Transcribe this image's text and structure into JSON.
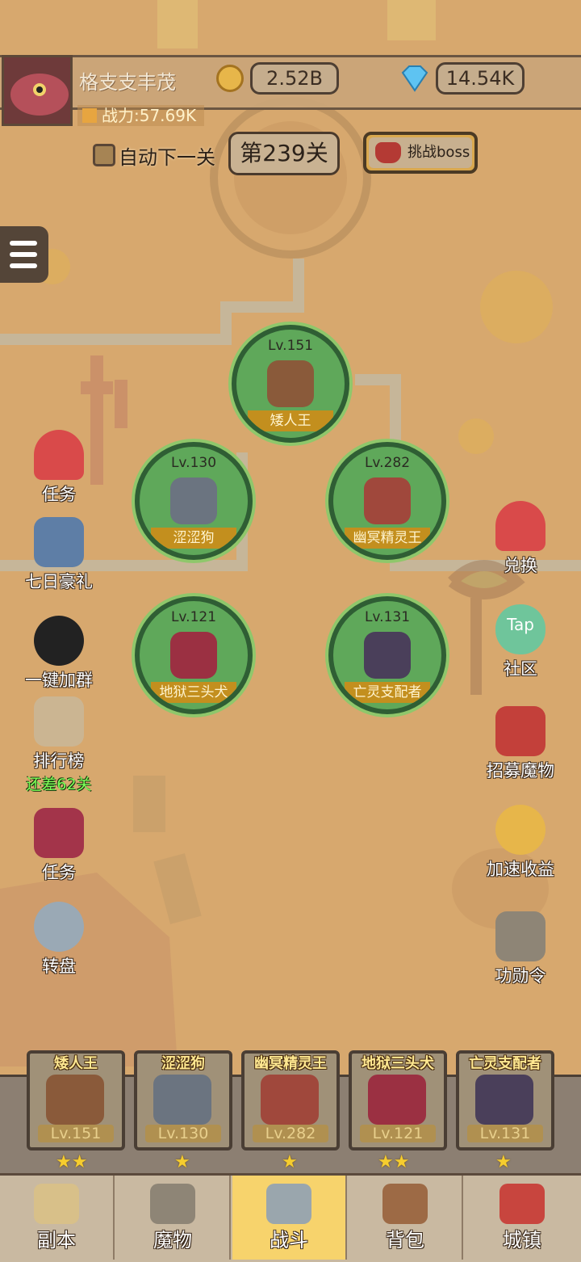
{
  "player": {
    "name": "格支支丰茂",
    "power": "战力:57.69K"
  },
  "currency": {
    "gold": "2.52B",
    "diamond": "14.54K"
  },
  "controls": {
    "auto_next": "自动下一关",
    "stage": "第239关",
    "boss": "挑战boss"
  },
  "monsters": [
    {
      "level": "Lv.151",
      "name": "矮人王"
    },
    {
      "level": "Lv.130",
      "name": "涩涩狗"
    },
    {
      "level": "Lv.282",
      "name": "幽冥精灵王"
    },
    {
      "level": "Lv.121",
      "name": "地狱三头犬"
    },
    {
      "level": "Lv.131",
      "name": "亡灵支配者"
    }
  ],
  "left_menu": [
    {
      "label": "任务",
      "icon": "candy-cane-icon"
    },
    {
      "label": "七日豪礼",
      "icon": "knight-helmet-icon"
    },
    {
      "label": "一键加群",
      "icon": "penguin-icon"
    },
    {
      "label": "排行榜",
      "icon": "scroll-icon",
      "sub": "还差62关"
    },
    {
      "label": "任务",
      "icon": "book-icon"
    },
    {
      "label": "转盘",
      "icon": "wheel-icon"
    }
  ],
  "right_menu": [
    {
      "label": "兑换",
      "icon": "candy-cane-icon"
    },
    {
      "label": "社区",
      "icon": "tap-cloud-icon",
      "badge": "Tap"
    },
    {
      "label": "招募魔物",
      "icon": "banner-helmet-icon"
    },
    {
      "label": "加速收益",
      "icon": "coin-up-icon"
    },
    {
      "label": "功勋令",
      "icon": "helmet-icon"
    }
  ],
  "team": [
    {
      "name": "矮人王",
      "level": "Lv.151",
      "stars": "★★"
    },
    {
      "name": "涩涩狗",
      "level": "Lv.130",
      "stars": "★"
    },
    {
      "name": "幽冥精灵王",
      "level": "Lv.282",
      "stars": "★"
    },
    {
      "name": "地狱三头犬",
      "level": "Lv.121",
      "stars": "★★"
    },
    {
      "name": "亡灵支配者",
      "level": "Lv.131",
      "stars": "★"
    }
  ],
  "nav": [
    {
      "label": "副本",
      "icon": "map-icon"
    },
    {
      "label": "魔物",
      "icon": "helmet-icon"
    },
    {
      "label": "战斗",
      "icon": "crossed-swords-icon",
      "active": true
    },
    {
      "label": "背包",
      "icon": "backpack-icon"
    },
    {
      "label": "城镇",
      "icon": "shop-icon"
    }
  ],
  "colors": {
    "accent": "#f7d36c",
    "monster_circle": "#5fa85a",
    "name_ribbon": "#c38f1e"
  }
}
